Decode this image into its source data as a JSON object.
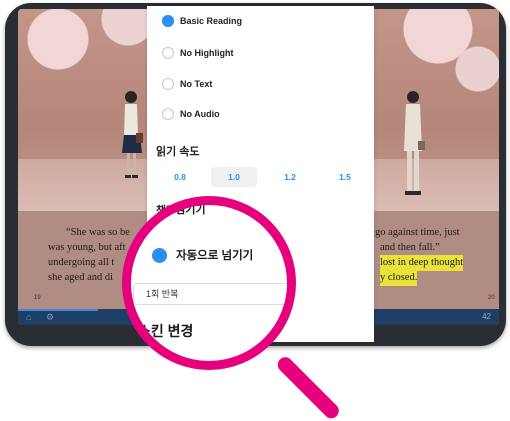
{
  "reader": {
    "text_lines": [
      {
        "left": "“She  was  so  be",
        "right": "go  against  time,  just"
      },
      {
        "left": "was young, but aft",
        "right": "and then fall.”"
      },
      {
        "left": "undergoing  all  t",
        "right_plain": "",
        "right_hl": "lost in deep thought"
      },
      {
        "left": "she aged and di",
        "right_hl": "y closed."
      }
    ],
    "page_left": "19",
    "page_right": "20",
    "page_counter": "42"
  },
  "panel": {
    "modes": [
      {
        "label": "Basic Reading",
        "selected": true
      },
      {
        "label": "No Highlight",
        "selected": false
      },
      {
        "label": "No Text",
        "selected": false
      },
      {
        "label": "No Audio",
        "selected": false
      }
    ],
    "speed_title": "읽기 속도",
    "speeds": [
      {
        "label": "0.8",
        "selected": false
      },
      {
        "label": "1.0",
        "selected": true
      },
      {
        "label": "1.2",
        "selected": false
      },
      {
        "label": "1.5",
        "selected": false
      }
    ],
    "page_turn_title": "책장 넘기기",
    "auto_turn_label": "자동으로 넘기기",
    "repeat_value": "1회 반복",
    "skin_title": "스킨 변경"
  },
  "colors": {
    "accent": "#2b8ef0",
    "magnifier": "#e6007e",
    "highlight": "#e8e33a"
  }
}
